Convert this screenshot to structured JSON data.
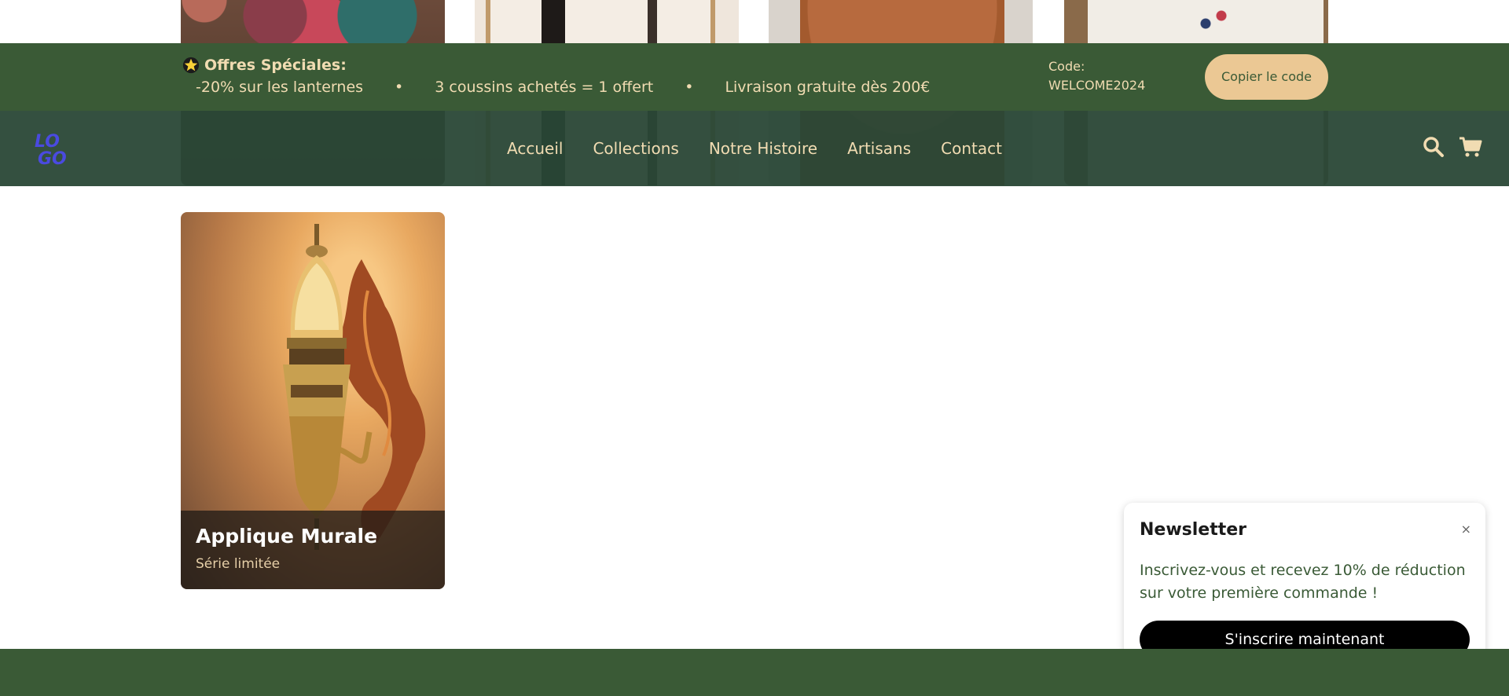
{
  "promo": {
    "title": "Offres Spéciales:",
    "offers": [
      "-20% sur les lanternes",
      "3 coussins achetés = 1 offert",
      "Livraison gratuite dès 200€"
    ],
    "separator": "•",
    "code_label": "Code:",
    "code_value": "WELCOME2024",
    "copy_button": "Copier le code"
  },
  "nav": {
    "logo_text": "LOGO",
    "links": [
      "Accueil",
      "Collections",
      "Notre Histoire",
      "Artisans",
      "Contact"
    ],
    "icons": [
      "search-icon",
      "cart-icon"
    ]
  },
  "product": {
    "title": "Applique Murale",
    "subtitle": "Série limitée"
  },
  "newsletter": {
    "title": "Newsletter",
    "close": "×",
    "text": "Inscrivez-vous et recevez 10% de réduction sur votre première commande !",
    "button": "S'inscrire maintenant"
  },
  "colors": {
    "promo_bg": "#3a5a36",
    "nav_bg": "#294736",
    "accent": "#ebc894",
    "text_gold": "#f1dcb2",
    "logo": "#4a4ae0"
  }
}
